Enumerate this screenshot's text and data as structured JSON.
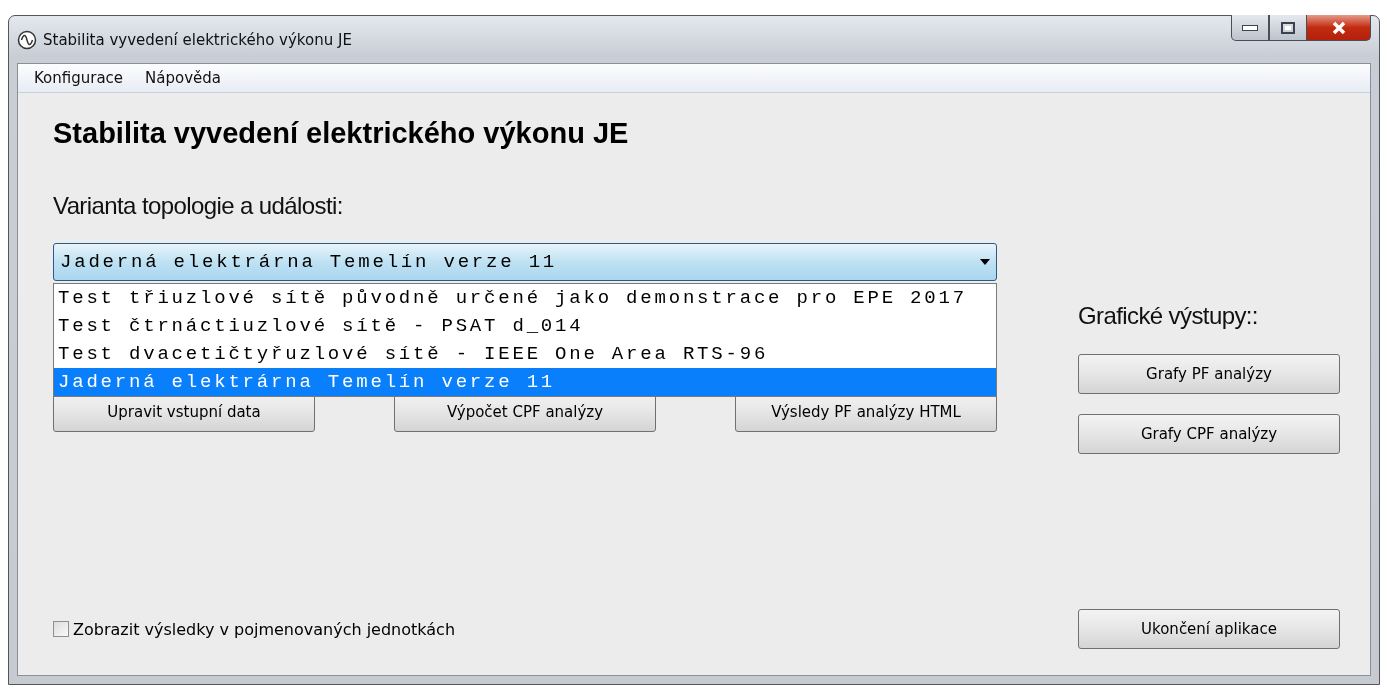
{
  "window": {
    "title": "Stabilita vyvedení elektrického výkonu JE"
  },
  "menu": [
    "Konfigurace",
    "Nápověda"
  ],
  "heading": "Stabilita vyvedení elektrického výkonu JE",
  "variant_label": "Varianta topologie a události:",
  "variant_combo": {
    "value": "Jaderná elektrárna Temelín verze 11",
    "expanded": true,
    "options": [
      {
        "label": "Test třiuzlové sítě původně určené jako demonstrace pro EPE 2017",
        "selected": false
      },
      {
        "label": "Test čtrnáctiuzlové sítě - PSAT d_014",
        "selected": false
      },
      {
        "label": "Test dvacetičtyřuzlové sítě - IEEE One Area RTS-96",
        "selected": false
      },
      {
        "label": "Jaderná elektrárna Temelín verze 11",
        "selected": true
      }
    ]
  },
  "action_buttons": [
    "Upravit vstupní data",
    "Výpočet CPF analýzy",
    "Výsledy PF analýzy HTML"
  ],
  "graphics_label": "Grafické výstupy::",
  "graphics_buttons": [
    "Grafy PF analýzy",
    "Grafy CPF analýzy"
  ],
  "named_units_checkbox": {
    "label": "Zobrazit výsledky v pojmenovaných jednotkách",
    "checked": false
  },
  "exit_button": "Ukončení aplikace"
}
